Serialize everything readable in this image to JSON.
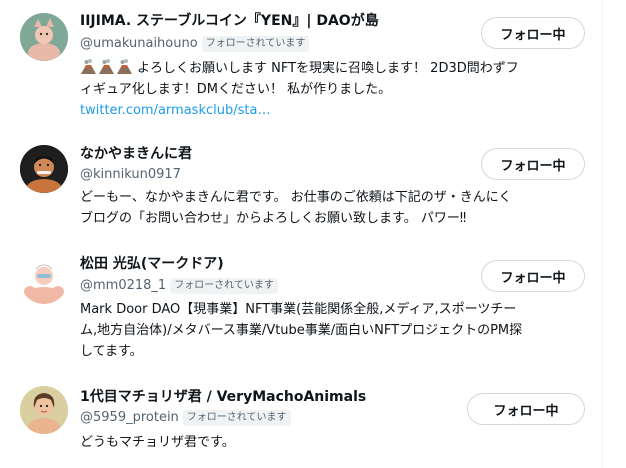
{
  "users": [
    {
      "name": "IIJIMA. ステーブルコイン『YEN』| DAOが島",
      "handle": "@umakunaihouno",
      "follows_you": "フォローされています",
      "button_label": "フォロー中",
      "bio_text": "よろしくお願いします NFTを現実に召喚します！ 2D3D問わずフ",
      "bio_line2": "ィギュア化します！DMください！ 私が作りました。",
      "bio_link": "twitter.com/armaskclub/sta…",
      "emoji_icons": [
        "volcano-icon",
        "volcano-icon",
        "volcano-icon"
      ]
    },
    {
      "name": "なかやまきんに君",
      "handle": "@kinnikun0917",
      "follows_you": "",
      "button_label": "フォロー中",
      "bio_line1": "どーもー、なかやまきんに君です。 お仕事のご依頼は下記のザ・きんにく",
      "bio_line2": "ブログの「お問い合わせ」からよろしくお願い致します。 パワー‼"
    },
    {
      "name": "松田 光弘(マークドア)",
      "handle": "@mm0218_1",
      "follows_you": "フォローされています",
      "button_label": "フォロー中",
      "bio_line1": "Mark Door DAO【現事業】NFT事業(芸能関係全般,メディア,スポーツチー",
      "bio_line2": "ム,地方自治体)/メタバース事業/Vtube事業/面白いNFTプロジェクトのPM探",
      "bio_line3": "してます。"
    },
    {
      "name": "1代目マチョリザ君 / VeryMachoAnimals",
      "handle": "@5959_protein",
      "follows_you": "フォローされています",
      "button_label": "フォロー中",
      "bio_line1": "どうもマチョリザ君です。"
    }
  ],
  "colors": {
    "link": "#1d9bf0",
    "secondary_text": "#536471",
    "badge_bg": "#eff3f4",
    "button_border": "#cfd9de"
  }
}
